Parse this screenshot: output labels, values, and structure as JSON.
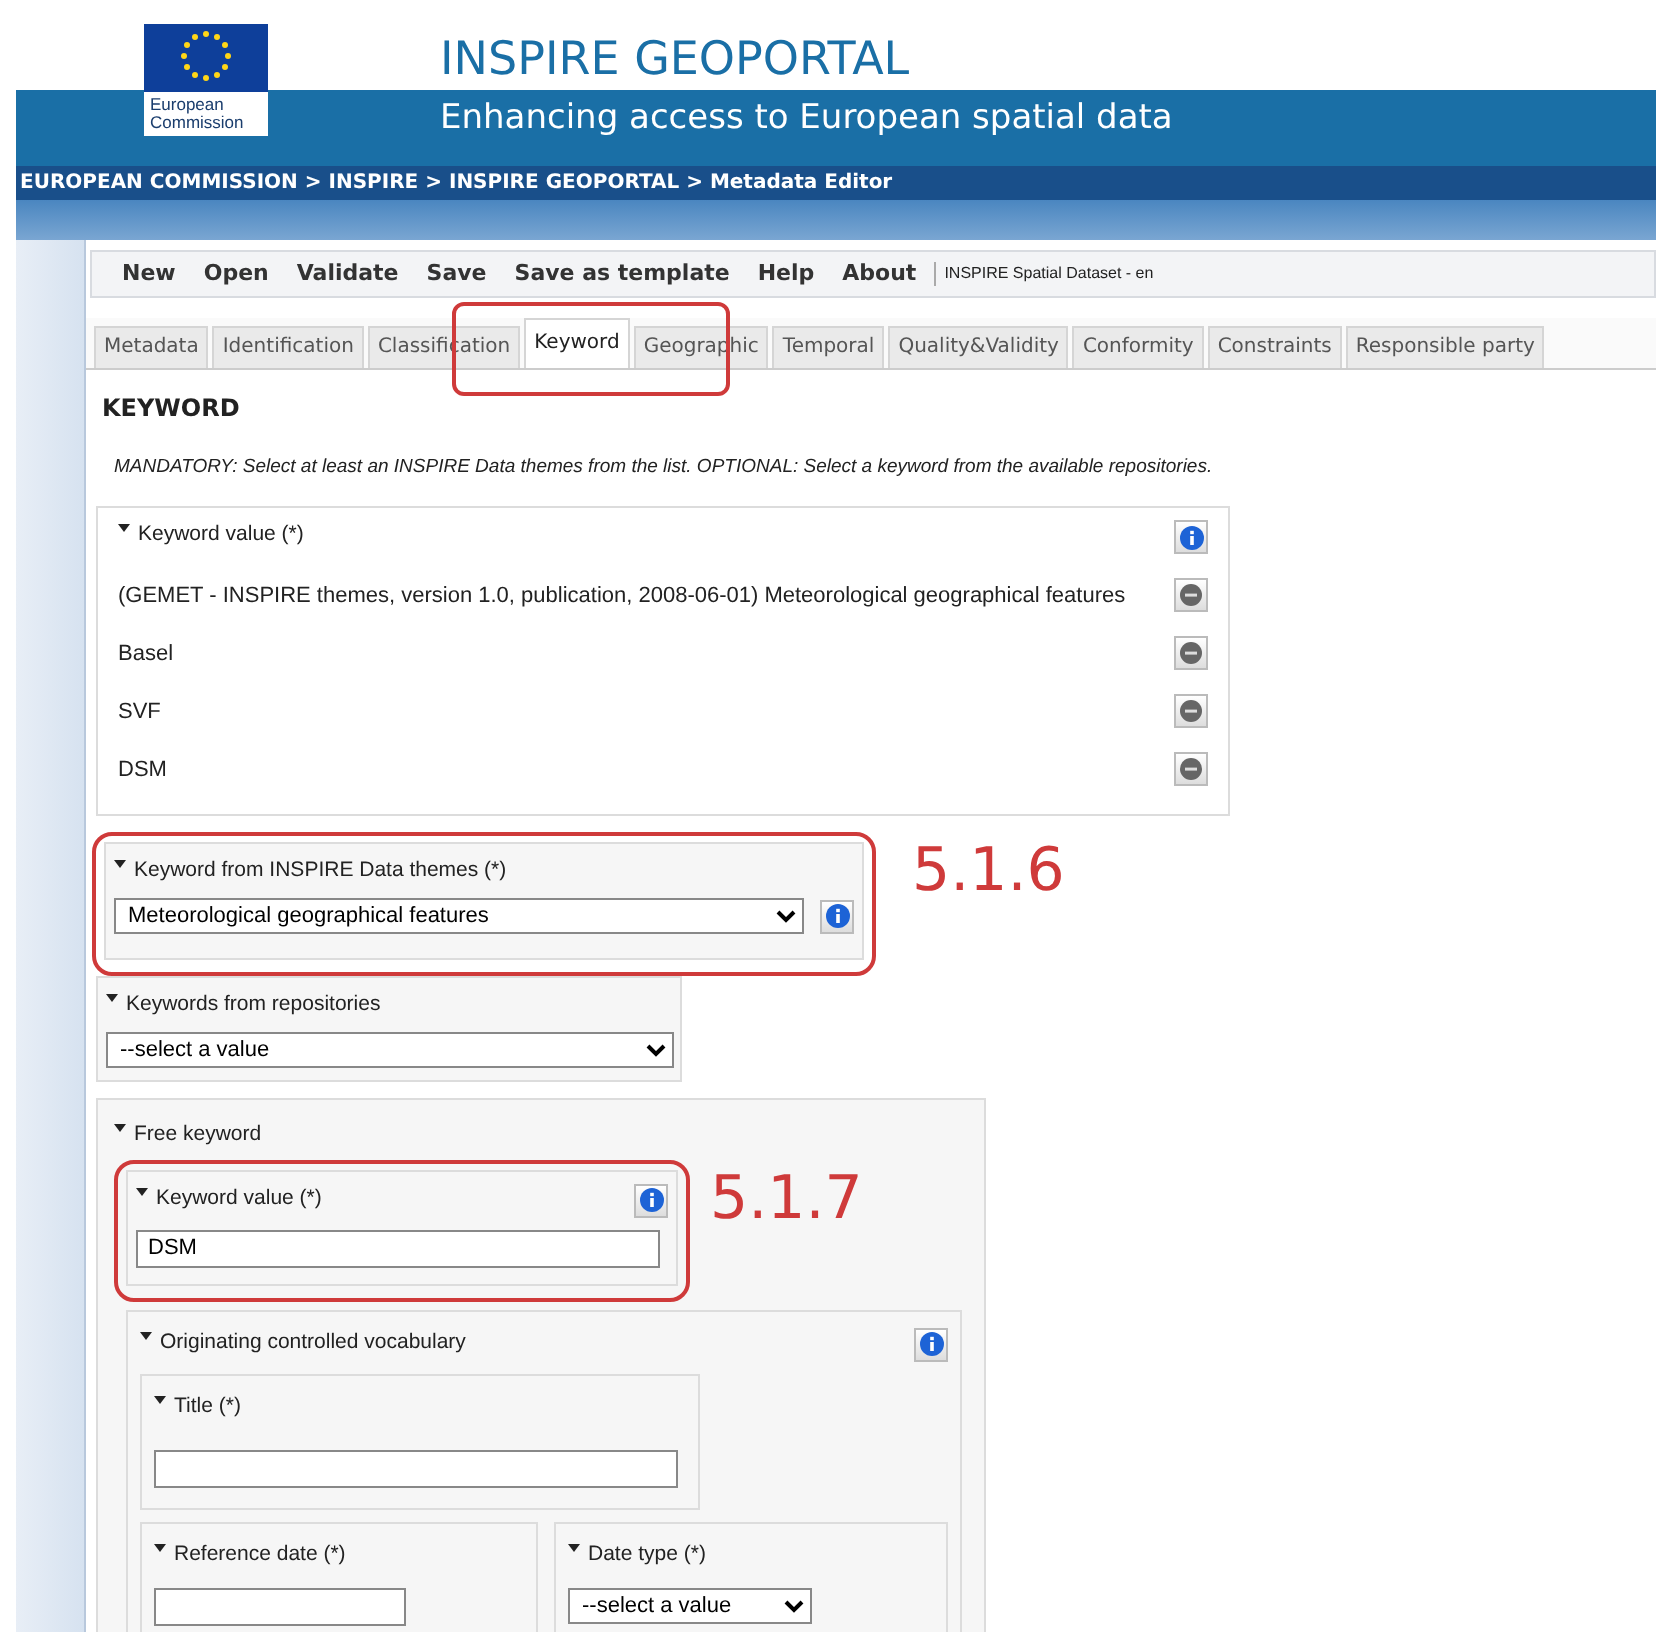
{
  "header": {
    "logo_text": "European Commission",
    "title": "INSPIRE GEOPORTAL",
    "subtitle": "Enhancing access to European spatial data"
  },
  "breadcrumb": "EUROPEAN COMMISSION > INSPIRE > INSPIRE GEOPORTAL > Metadata Editor",
  "menu": {
    "items": [
      "New",
      "Open",
      "Validate",
      "Save",
      "Save as template",
      "Help",
      "About"
    ],
    "document": "INSPIRE Spatial Dataset - en"
  },
  "tabs": [
    {
      "label": "Metadata",
      "selected": false,
      "highlighted": false
    },
    {
      "label": "Identification",
      "selected": false,
      "highlighted": false
    },
    {
      "label": "Classification",
      "selected": false,
      "highlighted": false
    },
    {
      "label": "Keyword",
      "selected": true,
      "highlighted": true
    },
    {
      "label": "Geographic",
      "selected": false,
      "highlighted": false
    },
    {
      "label": "Temporal",
      "selected": false,
      "highlighted": false
    },
    {
      "label": "Quality&Validity",
      "selected": false,
      "highlighted": false
    },
    {
      "label": "Conformity",
      "selected": false,
      "highlighted": false
    },
    {
      "label": "Constraints",
      "selected": false,
      "highlighted": false
    },
    {
      "label": "Responsible party",
      "selected": false,
      "highlighted": false
    }
  ],
  "heading": "KEYWORD",
  "instruction": "MANDATORY: Select at least an INSPIRE Data themes from the list. OPTIONAL: Select a keyword from the available repositories.",
  "keyword_value": {
    "title": "Keyword value (*)",
    "values": [
      "(GEMET - INSPIRE themes, version 1.0, publication, 2008-06-01) Meteorological geographical features",
      "Basel",
      "SVF",
      "DSM"
    ]
  },
  "inspire_theme": {
    "title": "Keyword from INSPIRE Data themes (*)",
    "value": "Meteorological geographical features",
    "annotation": "5.1.6"
  },
  "repositories": {
    "title": "Keywords from repositories",
    "value": "--select a value"
  },
  "free_keyword": {
    "title": "Free keyword",
    "keyword_value": {
      "title": "Keyword value (*)",
      "value": "DSM",
      "annotation": "5.1.7"
    },
    "vocabulary": {
      "title": "Originating controlled vocabulary",
      "title_field": {
        "label": "Title (*)"
      },
      "reference_date": {
        "label": "Reference date (*)"
      },
      "date_type": {
        "label": "Date type (*)",
        "value": "--select a value"
      }
    }
  }
}
